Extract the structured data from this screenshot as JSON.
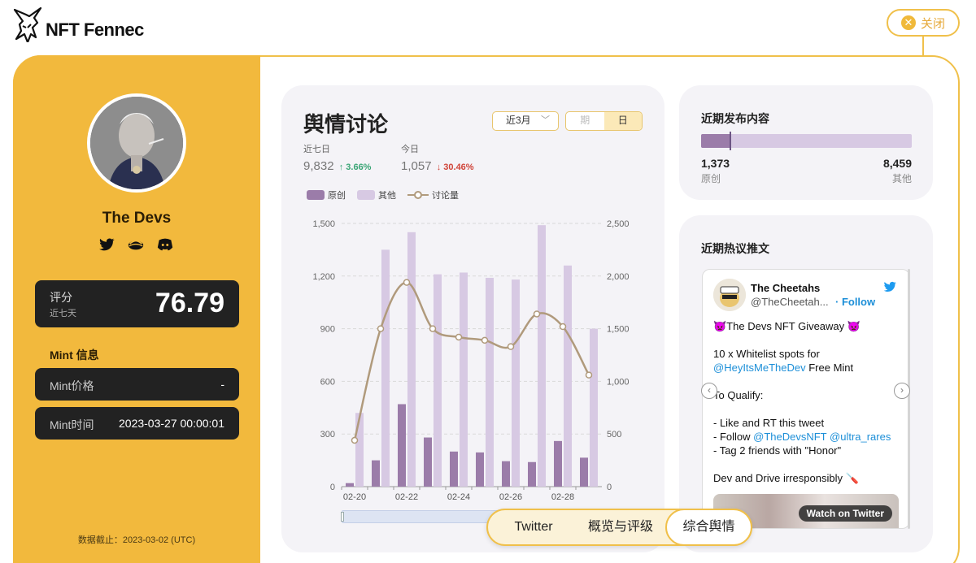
{
  "header": {
    "brand": "NFT Fennec",
    "close_label": "关闭"
  },
  "profile": {
    "name": "The Devs",
    "socials": [
      "twitter-icon",
      "opensea-icon",
      "discord-icon"
    ],
    "score_label": "评分",
    "score_sub": "近七天",
    "score_value": "76.79",
    "mint_title": "Mint 信息",
    "mint_price_label": "Mint价格",
    "mint_price_value": "-",
    "mint_time_label": "Mint时间",
    "mint_time_value": "2023-03-27 00:00:01",
    "data_cutoff": "数据截止：2023-03-02 (UTC)"
  },
  "discussion": {
    "title": "舆情讨论",
    "range_value": "近3月",
    "granularity_options": [
      "期",
      "日"
    ],
    "granularity_selected": "日",
    "stats": [
      {
        "label": "近七日",
        "value": "9,832",
        "change": "↑ 3.66%",
        "direction": "up"
      },
      {
        "label": "今日",
        "value": "1,057",
        "change": "↓ 30.46%",
        "direction": "down"
      }
    ],
    "legend": [
      "原创",
      "其他",
      "讨论量"
    ]
  },
  "chart_data": {
    "type": "bar",
    "categories": [
      "02-20",
      "02-21",
      "02-22",
      "02-23",
      "02-24",
      "02-25",
      "02-26",
      "02-27",
      "02-28",
      "03-01"
    ],
    "x_tick_labels": [
      "02-20",
      "02-22",
      "02-24",
      "02-26",
      "02-28"
    ],
    "series": [
      {
        "name": "原创",
        "values": [
          20,
          150,
          470,
          280,
          200,
          195,
          145,
          140,
          260,
          165
        ],
        "color": "#9b7ca9",
        "axis": "left"
      },
      {
        "name": "其他",
        "values": [
          420,
          1350,
          1450,
          1210,
          1220,
          1190,
          1180,
          1490,
          1260,
          900
        ],
        "color": "#d7c9e3",
        "axis": "left"
      },
      {
        "name": "讨论量",
        "type": "line",
        "values": [
          440,
          1500,
          1940,
          1500,
          1420,
          1390,
          1330,
          1640,
          1520,
          1060
        ],
        "color": "#b09a7c",
        "axis": "right"
      }
    ],
    "y_left": {
      "ticks": [
        "0",
        "300",
        "600",
        "900",
        "1,200",
        "1,500"
      ],
      "lim": [
        0,
        1500
      ]
    },
    "y_right": {
      "ticks": [
        "0",
        "500",
        "1,000",
        "1,500",
        "2,000",
        "2,500"
      ],
      "lim": [
        0,
        2500
      ]
    },
    "grid": true
  },
  "published": {
    "title": "近期发布内容",
    "original_count": "1,373",
    "original_label": "原创",
    "other_count": "8,459",
    "other_label": "其他",
    "original_share": 0.14
  },
  "hot_tweets": {
    "title": "近期热议推文",
    "tweet": {
      "author": "The Cheetahs",
      "handle": "@TheCheetah...",
      "follow": "· Follow",
      "line1": "👿The Devs NFT Giveaway 👿",
      "line2a": "10 x Whitelist spots for",
      "line2b_link": "@HeyItsMeTheDev",
      "line2b_rest": " Free Mint",
      "line3": "To Qualify:",
      "line4": "- Like and RT this tweet",
      "line5_pre": "- Follow ",
      "line5_link1": "@TheDevsNFT",
      "line5_mid": " ",
      "line5_link2": "@ultra_rares",
      "line6": "- Tag 2 friends with \"Honor\"",
      "line7": "Dev and Drive irresponsibly 🪛",
      "media_label": "Watch on Twitter"
    }
  },
  "tabs": [
    "Twitter",
    "概览与评级",
    "综合舆情"
  ],
  "active_tab": "综合舆情"
}
